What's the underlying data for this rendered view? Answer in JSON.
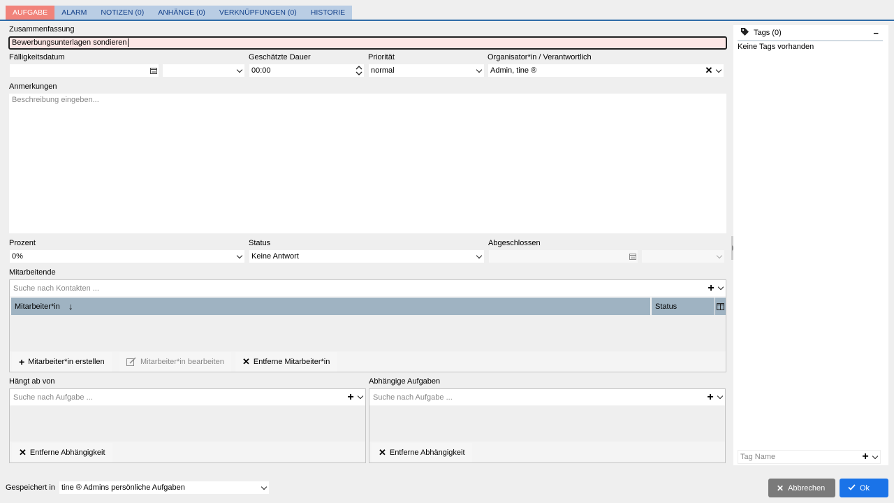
{
  "tabs": [
    {
      "label": "AUFGABE"
    },
    {
      "label": "ALARM"
    },
    {
      "label": "NOTIZEN (0)"
    },
    {
      "label": "ANHÄNGE (0)"
    },
    {
      "label": "VERKNÜPFUNGEN (0)"
    },
    {
      "label": "HISTORIE"
    }
  ],
  "form": {
    "summary_label": "Zusammenfassung",
    "summary_value": "Bewerbungsunterlagen sondieren",
    "due_label": "Fälligkeitsdatum",
    "duration_label": "Geschätzte Dauer",
    "duration_value": "00:00",
    "priority_label": "Priorität",
    "priority_value": "normal",
    "organizer_label": "Organisator*in / Verantwortlich",
    "organizer_value": "Admin, tine ®",
    "notes_label": "Anmerkungen",
    "notes_placeholder": "Beschreibung eingeben...",
    "percent_label": "Prozent",
    "percent_value": "0%",
    "status_label": "Status",
    "status_value": "Keine Antwort",
    "completed_label": "Abgeschlossen"
  },
  "attendees": {
    "label": "Mitarbeitende",
    "search_placeholder": "Suche nach Kontakten ...",
    "col_name": "Mitarbeiter*in",
    "col_status": "Status",
    "sort_arrow": "↓",
    "btn_create": "Mitarbeiter*in erstellen",
    "btn_edit": "Mitarbeiter*in bearbeiten",
    "btn_remove": "Entferne Mitarbeiter*in"
  },
  "depends_on": {
    "label": "Hängt ab von",
    "search_placeholder": "Suche nach Aufgabe ...",
    "btn_remove": "Entferne Abhängigkeit"
  },
  "dependent": {
    "label": "Abhängige Aufgaben",
    "search_placeholder": "Suche nach Aufgabe ...",
    "btn_remove": "Entferne Abhängigkeit"
  },
  "tags": {
    "title": "Tags (0)",
    "collapse": "−",
    "empty_text": "Keine Tags vorhanden",
    "input_placeholder": "Tag Name"
  },
  "footer": {
    "saved_in_label": "Gespeichert in",
    "saved_in_value": "tine ® Admins persönliche Aufgaben",
    "cancel_label": "Abbrechen",
    "ok_label": "Ok"
  },
  "colors": {
    "active_tab": "#f1837a",
    "tab": "#b9cde4",
    "cancel_button": "#7a7a7a",
    "ok_button": "#1a73e8"
  }
}
